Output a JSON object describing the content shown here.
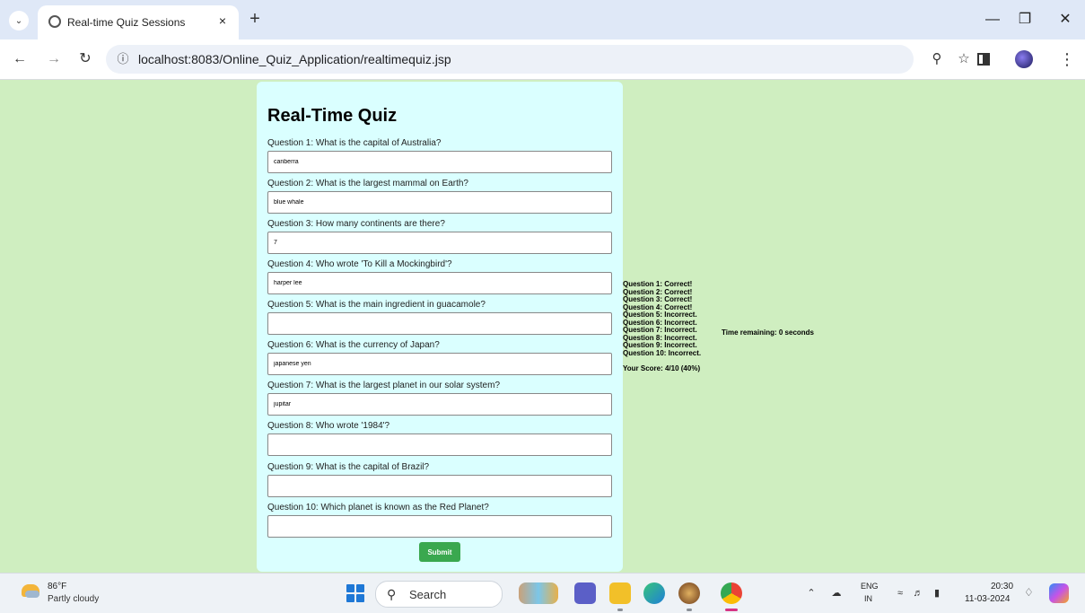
{
  "browser": {
    "tab_title": "Real-time Quiz Sessions",
    "tab_close": "×",
    "new_tab": "+",
    "url": "localhost:8083/Online_Quiz_Application/realtimequiz.jsp",
    "window_buttons": {
      "minimize": "—",
      "restore": "❐",
      "close": "✕"
    },
    "icons": [
      "tab-list-icon",
      "globe-icon",
      "back-icon",
      "forward-icon",
      "reload-icon",
      "site-info-icon",
      "zoom-icon",
      "star-icon",
      "side-panel-icon",
      "avatar",
      "menu-icon"
    ]
  },
  "quiz": {
    "title": "Real-Time Quiz",
    "questions": [
      {
        "label": "Question 1: What is the capital of Australia?",
        "answer": "canberra"
      },
      {
        "label": "Question 2: What is the largest mammal on Earth?",
        "answer": "blue whale"
      },
      {
        "label": "Question 3: How many continents are there?",
        "answer": "7"
      },
      {
        "label": "Question 4: Who wrote 'To Kill a Mockingbird'?",
        "answer": "harper lee"
      },
      {
        "label": "Question 5: What is the main ingredient in guacamole?",
        "answer": ""
      },
      {
        "label": "Question 6: What is the currency of Japan?",
        "answer": "japanese yen"
      },
      {
        "label": "Question 7: What is the largest planet in our solar system?",
        "answer": "jupitar"
      },
      {
        "label": "Question 8: Who wrote '1984'?",
        "answer": ""
      },
      {
        "label": "Question 9: What is the capital of Brazil?",
        "answer": ""
      },
      {
        "label": "Question 10: Which planet is known as the Red Planet?",
        "answer": ""
      }
    ],
    "submit_label": "Submit"
  },
  "results": {
    "lines": [
      "Question 1: Correct!",
      "Question 2: Correct!",
      "Question 3: Correct!",
      "Question 4: Correct!",
      "Question 5: Incorrect.",
      "Question 6: Incorrect.",
      "Question 7: Incorrect.",
      "Question 8: Incorrect.",
      "Question 9: Incorrect.",
      "Question 10: Incorrect."
    ],
    "score": "Your Score: 4/10 (40%)",
    "timer": "Time remaining: 0 seconds"
  },
  "taskbar": {
    "weather_temp": "86°F",
    "weather_desc": "Partly cloudy",
    "search_placeholder": "Search",
    "lang_top": "ENG",
    "lang_bottom": "IN",
    "time": "20:30",
    "date": "11-03-2024"
  },
  "colors": {
    "page_background": "#cfeec0",
    "card_background": "#daffff",
    "submit_button": "#3aa84f"
  }
}
